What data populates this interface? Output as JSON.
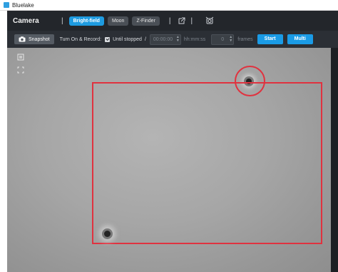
{
  "window": {
    "title": "Bluelake"
  },
  "header": {
    "title": "Camera",
    "separator": "|",
    "modes": [
      {
        "label": "Bright-field",
        "active": true
      },
      {
        "label": "Moon",
        "active": false
      },
      {
        "label": "Z-Finder",
        "active": false
      }
    ]
  },
  "toolbar": {
    "snapshot_label": "Snapshot",
    "record_label": "Turn On & Record:",
    "until_stopped_label": "Until stopped",
    "slash": "/",
    "time_placeholder": "00:00:00",
    "time_unit": "hh:mm:ss",
    "frames_placeholder": "0",
    "frames_unit": "frames",
    "start_label": "Start",
    "multi_label": "Multi"
  },
  "colors": {
    "accent": "#1e9be0",
    "roi": "#e0323f",
    "background": "#1c1f23"
  }
}
